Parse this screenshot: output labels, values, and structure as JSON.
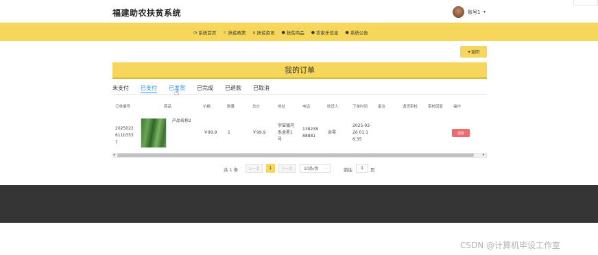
{
  "header": {
    "site_title": "福建助农扶贫系统",
    "account": "账号1",
    "caret": "▾"
  },
  "nav": {
    "items": [
      {
        "icon": "◷",
        "label": "系统首页"
      },
      {
        "icon": "☆",
        "label": "扶贫政策"
      },
      {
        "icon": "⌂",
        "label": "扶贫资讯"
      },
      {
        "icon": "●",
        "label": "扶贫商品"
      },
      {
        "icon": "●",
        "label": "农家乐信息"
      },
      {
        "icon": "●",
        "label": "系统公告"
      }
    ]
  },
  "back_button": {
    "icon": "◂",
    "label": "返回"
  },
  "order_title": "我的订单",
  "tabs": [
    "未支付",
    "已支付",
    "已发货",
    "已完成",
    "已退款",
    "已取消"
  ],
  "table": {
    "headers": [
      "订单编号",
      "商品",
      "价格",
      "数量",
      "总价",
      "地址",
      "电话",
      "收货人",
      "下单时间",
      "备注",
      "退货审核",
      "审核回复",
      "操作"
    ],
    "row": {
      "order_no": "2025022611b3537",
      "product_name": "产品名称2",
      "price": "￥99.9",
      "quantity": "1",
      "total": "￥99.9",
      "address": "宇宙银河系金星1号",
      "phone": "13823888881",
      "receiver": "余零",
      "order_time": "2025-02-26 01:16:35",
      "refund_action": "退款"
    }
  },
  "scrollbar": {
    "left_arrow": "◂",
    "right_arrow": "▸"
  },
  "pagination": {
    "total": "共 1 条",
    "prev": "上一页",
    "current_page": "1",
    "next": "下一页",
    "page_size": "10条/页",
    "goto_label": "前往",
    "goto_value": "1",
    "page_unit": "页"
  },
  "watermark": "CSDN @计算机毕设工作室",
  "colors": {
    "accent": "#f6d75b",
    "danger": "#f06b6b",
    "link": "#1e90ff",
    "footer": "#353535"
  }
}
